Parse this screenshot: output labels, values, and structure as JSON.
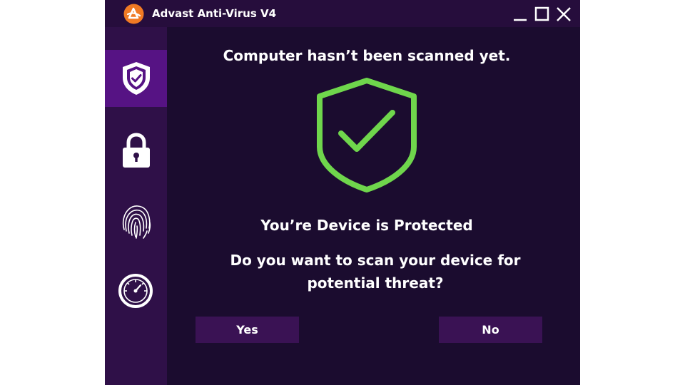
{
  "window": {
    "title": "Advast Anti-Virus V4",
    "icons": {
      "logo": "advast-logo-icon",
      "minimize": "minimize-icon",
      "maximize": "maximize-icon",
      "close": "close-icon"
    }
  },
  "sidebar": {
    "items": [
      {
        "icon": "shield-check-icon",
        "active": true
      },
      {
        "icon": "lock-icon",
        "active": false
      },
      {
        "icon": "fingerprint-icon",
        "active": false
      },
      {
        "icon": "speedometer-icon",
        "active": false
      }
    ]
  },
  "main": {
    "status_title": "Computer hasn’t been scanned yet.",
    "status_icon": "shield-check-icon",
    "protected_text": "You’re Device is Protected",
    "question_line1": "Do you want to scan your device for",
    "question_line2": "potential threat?",
    "yes_label": "Yes",
    "no_label": "No"
  },
  "colors": {
    "window_bg": "#1b0c2f",
    "titlebar_bg": "#260d3c",
    "sidebar_bg": "#2f1048",
    "sidebar_active": "#561384",
    "button_bg": "#3a1254",
    "shield_green": "#6fd64c",
    "logo_orange": "#f07a24"
  }
}
